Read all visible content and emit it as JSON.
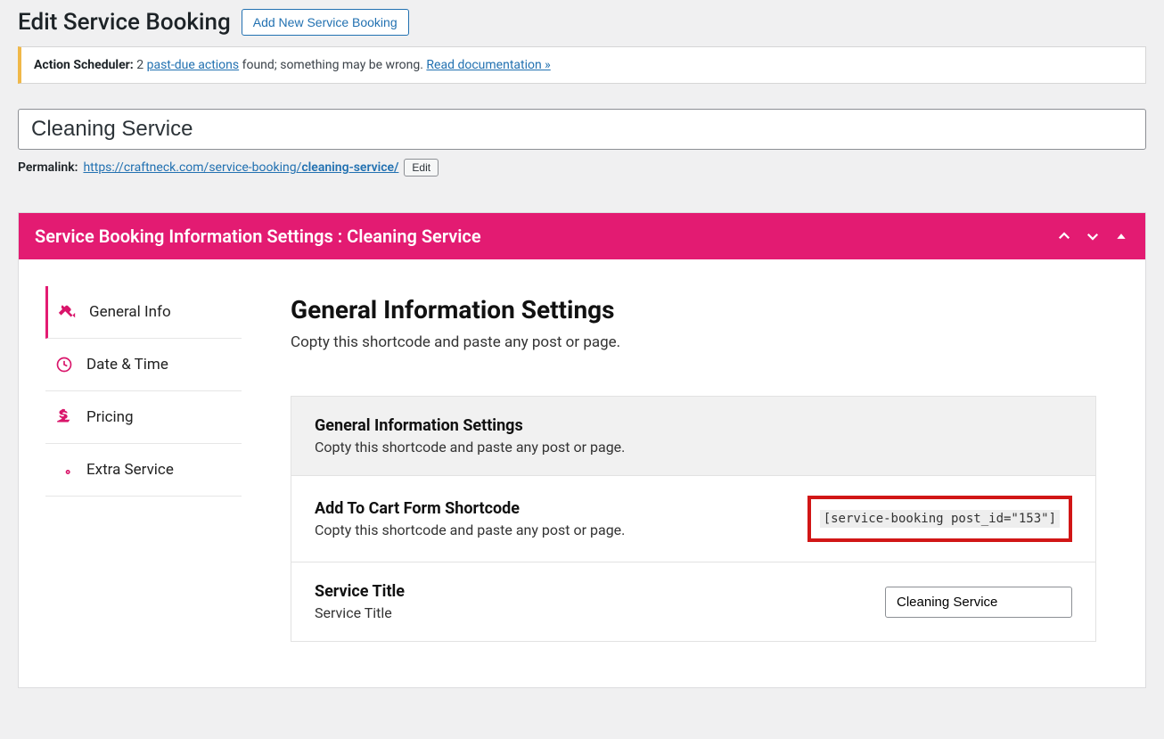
{
  "header": {
    "page_title": "Edit Service Booking",
    "add_new_label": "Add New Service Booking"
  },
  "notice": {
    "prefix": "Action Scheduler:",
    "count": "2",
    "link1": "past-due actions",
    "middle": " found; something may be wrong. ",
    "link2": "Read documentation »"
  },
  "title_input": {
    "value": "Cleaning Service"
  },
  "permalink": {
    "label": "Permalink:",
    "base": "https://craftneck.com/service-booking/",
    "slug": "cleaning-service/",
    "edit_label": "Edit"
  },
  "panel": {
    "title": "Service Booking Information Settings : Cleaning Service"
  },
  "tabs": {
    "general": "General Info",
    "datetime": "Date & Time",
    "pricing": "Pricing",
    "extra": "Extra Service"
  },
  "content": {
    "section_title": "General Information Settings",
    "section_desc": "Copty this shortcode and paste any post or page.",
    "rows": {
      "header": {
        "title": "General Information Settings",
        "desc": "Copty this shortcode and paste any post or page."
      },
      "shortcode": {
        "title": "Add To Cart Form Shortcode",
        "desc": "Copty this shortcode and paste any post or page.",
        "code": "[service-booking post_id=\"153\"]"
      },
      "service_title": {
        "title": "Service Title",
        "desc": "Service Title",
        "value": "Cleaning Service"
      }
    }
  }
}
